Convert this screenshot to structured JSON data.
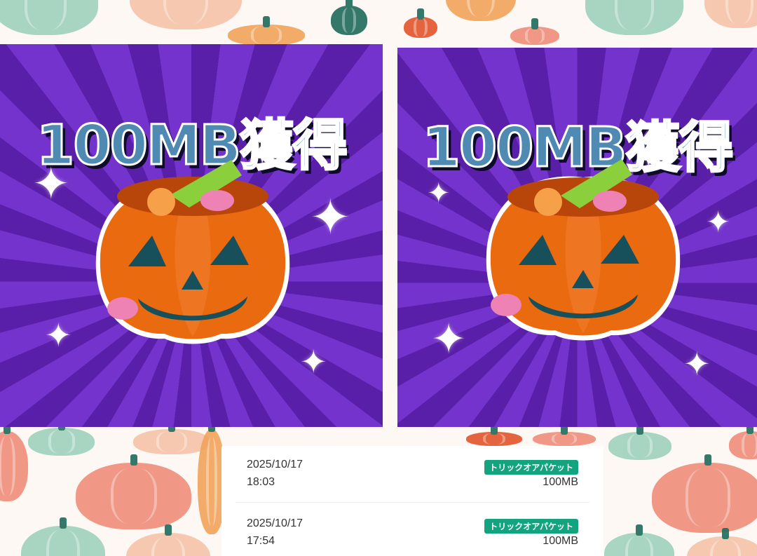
{
  "banners": [
    {
      "title": "100MB獲得",
      "image": "jack-o-lantern-candy-bucket"
    },
    {
      "title": "100MB獲得",
      "image": "jack-o-lantern-candy-bucket"
    }
  ],
  "history": [
    {
      "date": "2025/10/17",
      "time": "18:03",
      "badge": "トリックオアパケット",
      "amount": "100MB"
    },
    {
      "date": "2025/10/17",
      "time": "17:54",
      "badge": "トリックオアパケット",
      "amount": "100MB"
    }
  ],
  "colors": {
    "banner_purple": "#6a2ac1",
    "title_blue": "#4f8ab3",
    "badge_green": "#14a37f",
    "pumpkin_orange": "#ea6a10"
  }
}
